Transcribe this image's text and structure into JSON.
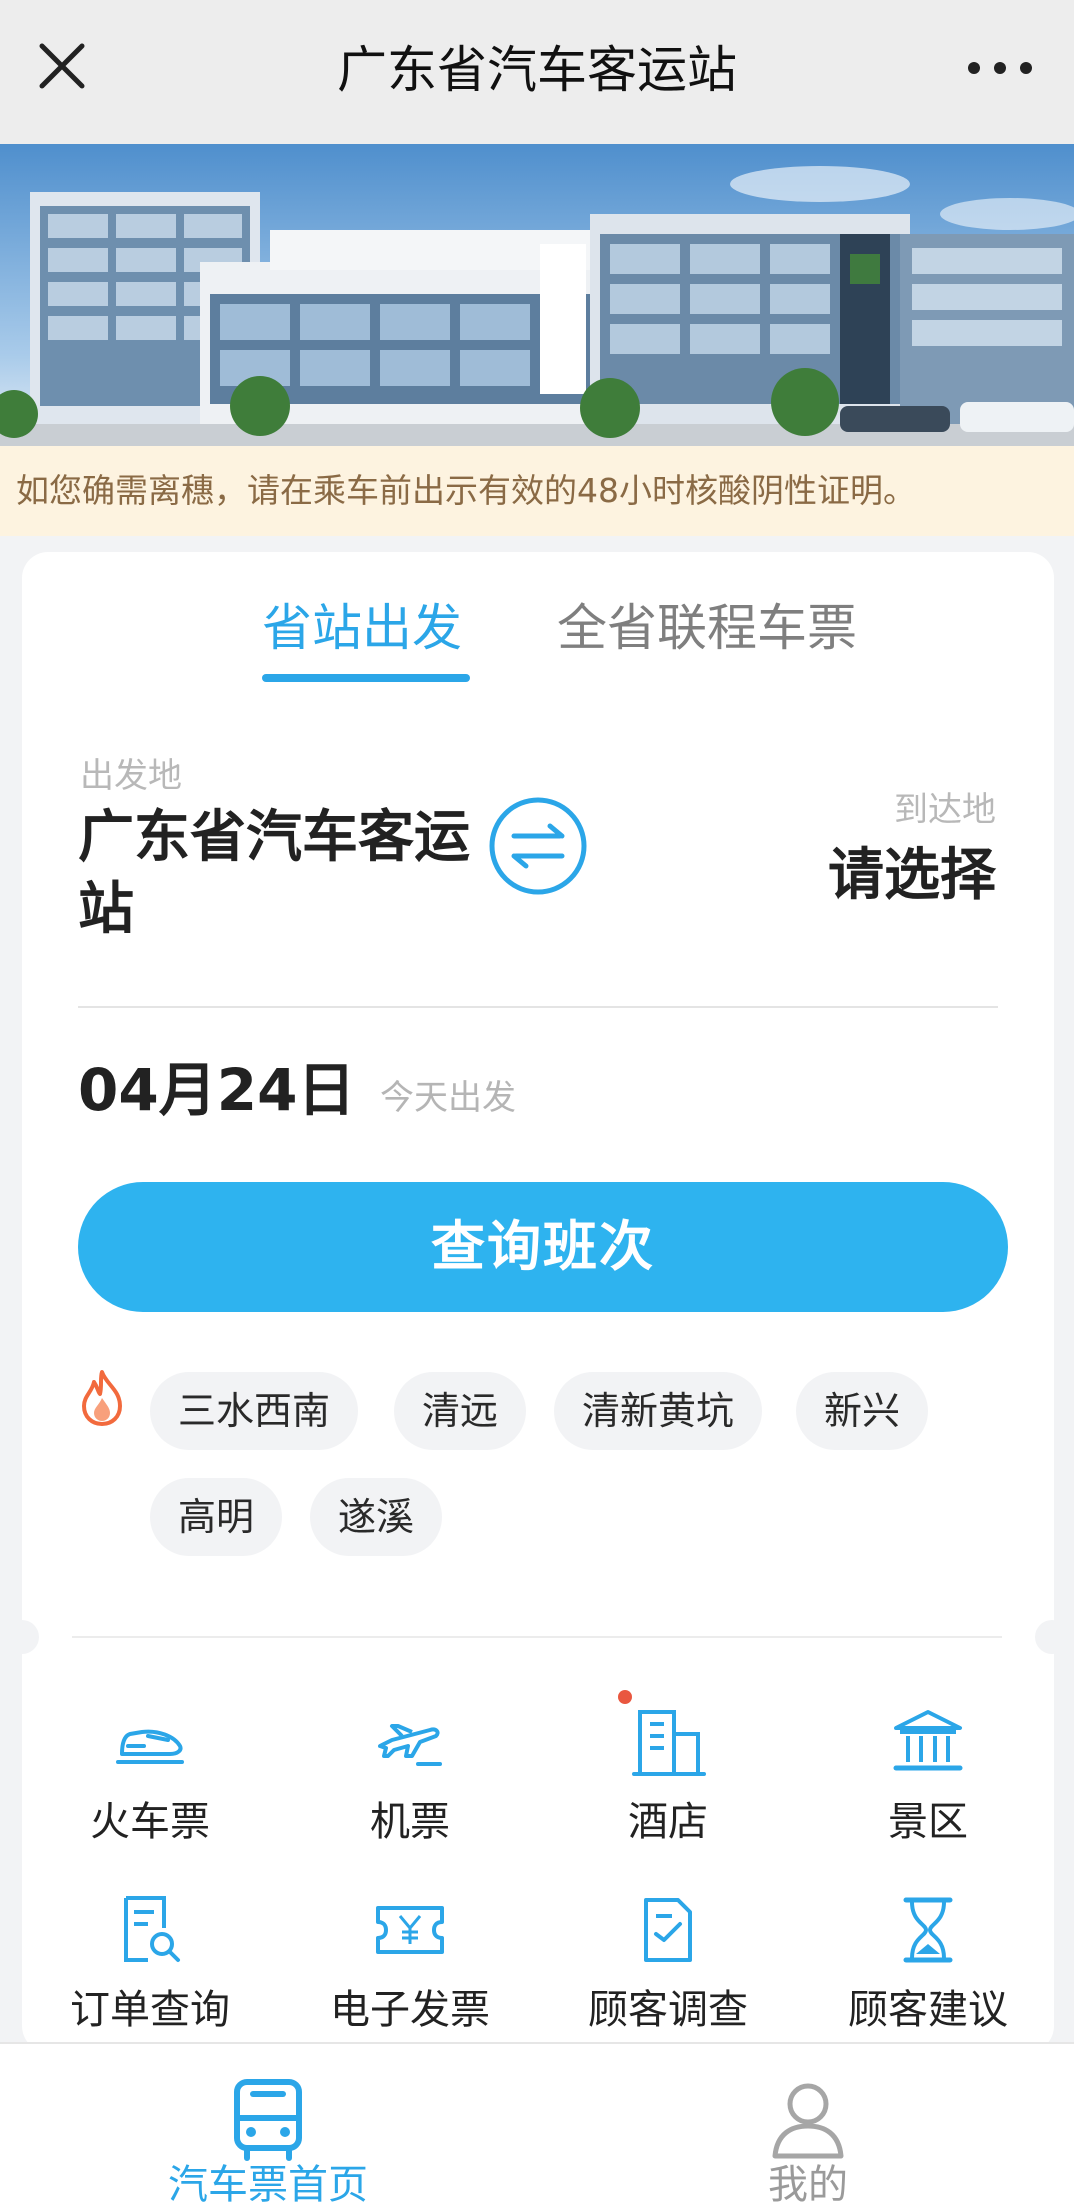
{
  "nav": {
    "title": "广东省汽车客运站"
  },
  "notice": "如您确需离穗，请在乘车前出示有效的48小时核酸阴性证明。",
  "tabs": [
    {
      "label": "省站出发",
      "active": true
    },
    {
      "label": "全省联程车票",
      "active": false
    }
  ],
  "trip": {
    "from_label": "出发地",
    "from_value": "广东省汽车客运站",
    "to_label": "到达地",
    "to_value": "请选择",
    "date": "04月24日",
    "date_note": "今天出发"
  },
  "query_button": "查询班次",
  "hot_destinations": [
    "三水西南",
    "清远",
    "清新黄坑",
    "新兴",
    "高明",
    "遂溪"
  ],
  "services": [
    {
      "label": "火车票",
      "icon": "train-icon"
    },
    {
      "label": "机票",
      "icon": "plane-icon"
    },
    {
      "label": "酒店",
      "icon": "hotel-icon",
      "badge": true
    },
    {
      "label": "景区",
      "icon": "scenic-icon"
    },
    {
      "label": "订单查询",
      "icon": "order-search-icon"
    },
    {
      "label": "电子发票",
      "icon": "invoice-icon"
    },
    {
      "label": "顾客调查",
      "icon": "survey-icon"
    },
    {
      "label": "顾客建议",
      "icon": "suggestion-icon"
    }
  ],
  "tabbar": [
    {
      "label": "汽车票首页",
      "icon": "bus-icon",
      "active": true
    },
    {
      "label": "我的",
      "icon": "user-icon",
      "active": false
    }
  ],
  "colors": {
    "accent": "#2ba6e8",
    "button": "#2eb3ef",
    "notice_bg": "#fdf3e0",
    "notice_text": "#8a6a45"
  }
}
